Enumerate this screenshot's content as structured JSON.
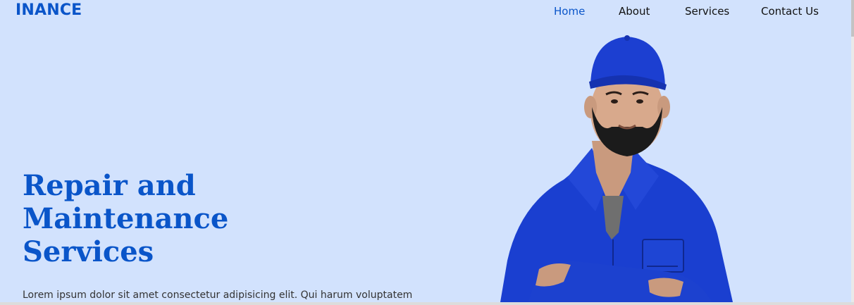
{
  "header": {
    "brand": "INANCE",
    "nav": [
      {
        "label": "Home",
        "active": true
      },
      {
        "label": "About",
        "active": false
      },
      {
        "label": "Services",
        "active": false
      },
      {
        "label": "Contact Us",
        "active": false
      }
    ]
  },
  "hero": {
    "title_lines": [
      "Repair and",
      "Maintenance",
      "Services"
    ],
    "description": "Lorem ipsum dolor sit amet consectetur adipisicing elit. Qui harum voluptatem",
    "image": "mechanic-in-blue-overalls-photo"
  },
  "colors": {
    "background": "#d2e2fd",
    "accent": "#0a55c9",
    "text": "#111111"
  }
}
